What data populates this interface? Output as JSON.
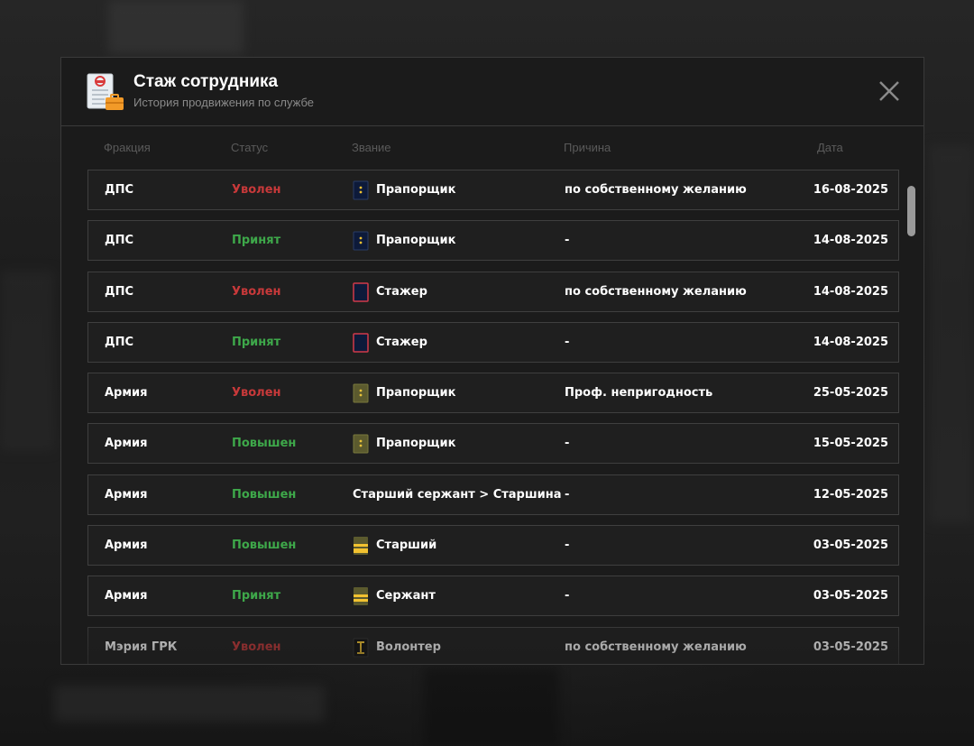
{
  "header": {
    "title": "Стаж сотрудника",
    "subtitle": "История продвижения по службе"
  },
  "columns": {
    "faction": "Фракция",
    "status": "Статус",
    "rank": "Звание",
    "reason": "Причина",
    "date": "Дата"
  },
  "colors": {
    "accent_red": "#c8393a",
    "accent_green": "#3ea84a",
    "panel_bg": "#1b1b1b",
    "row_border": "#3f3f3f"
  },
  "rows": [
    {
      "faction": "ДПС",
      "status": "Уволен",
      "status_type": "red",
      "rank_icon": "dps-praporshchik-shoulder-icon",
      "rank": "Прапорщик",
      "reason": "по собственному желанию",
      "date": "16-08-2025"
    },
    {
      "faction": "ДПС",
      "status": "Принят",
      "status_type": "green",
      "rank_icon": "dps-praporshchik-shoulder-icon",
      "rank": "Прапорщик",
      "reason": "-",
      "date": "14-08-2025"
    },
    {
      "faction": "ДПС",
      "status": "Уволен",
      "status_type": "red",
      "rank_icon": "dps-stazher-shoulder-icon",
      "rank": "Стажер",
      "reason": "по собственному желанию",
      "date": "14-08-2025"
    },
    {
      "faction": "ДПС",
      "status": "Принят",
      "status_type": "green",
      "rank_icon": "dps-stazher-shoulder-icon",
      "rank": "Стажер",
      "reason": "-",
      "date": "14-08-2025"
    },
    {
      "faction": "Армия",
      "status": "Уволен",
      "status_type": "red",
      "rank_icon": "army-praporshchik-shoulder-icon",
      "rank": "Прапорщик",
      "reason": "Проф. непригодность",
      "date": "25-05-2025"
    },
    {
      "faction": "Армия",
      "status": "Повышен",
      "status_type": "green",
      "rank_icon": "army-praporshchik-shoulder-icon",
      "rank": "Прапорщик",
      "reason": "-",
      "date": "15-05-2025"
    },
    {
      "faction": "Армия",
      "status": "Повышен",
      "status_type": "green",
      "rank_icon": "",
      "rank": "Старший сержант > Старшина",
      "reason": "-",
      "date": "12-05-2025"
    },
    {
      "faction": "Армия",
      "status": "Повышен",
      "status_type": "green",
      "rank_icon": "army-starshiy-shoulder-icon",
      "rank": "Старший",
      "reason": "-",
      "date": "03-05-2025"
    },
    {
      "faction": "Армия",
      "status": "Принят",
      "status_type": "green",
      "rank_icon": "army-serzhant-shoulder-icon",
      "rank": "Сержант",
      "reason": "-",
      "date": "03-05-2025"
    },
    {
      "faction": "Мэрия ГРК",
      "status": "Уволен",
      "status_type": "red",
      "rank_icon": "mayor-volonter-shoulder-icon",
      "rank": "Волонтер",
      "reason": "по собственному желанию",
      "date": "03-05-2025"
    }
  ]
}
